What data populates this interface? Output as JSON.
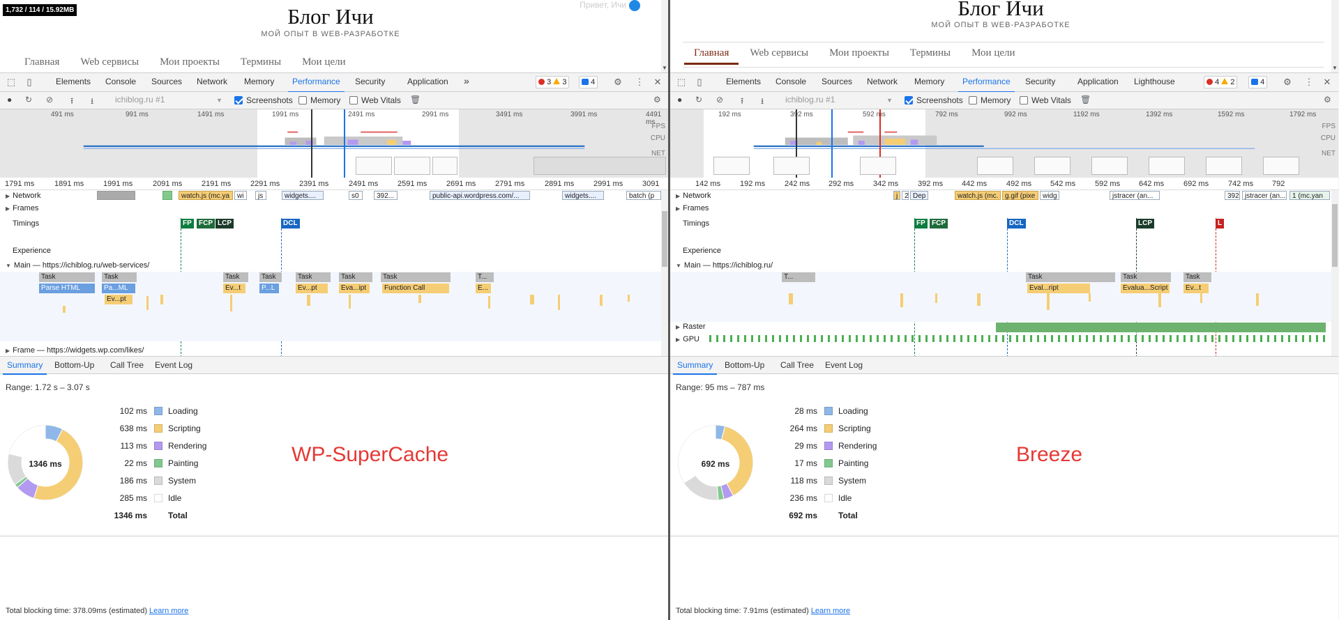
{
  "blog": {
    "title": "Блог Ичи",
    "subtitle": "МОЙ ОПЫТ В WEB-РАЗРАБОТКЕ",
    "nav": [
      "Главная",
      "Web сервисы",
      "Мои проекты",
      "Термины",
      "Мои цели"
    ],
    "greeting": "Привет, Ичи"
  },
  "fps_meter": "1,732 / 114 / 15.92MB",
  "devtools": {
    "tabs_left": [
      "Elements",
      "Console",
      "Sources",
      "Network",
      "Memory",
      "Performance",
      "Security",
      "Application"
    ],
    "tabs_right": [
      "Elements",
      "Console",
      "Sources",
      "Network",
      "Memory",
      "Performance",
      "Security",
      "Application",
      "Lighthouse"
    ],
    "active_tab": "Performance",
    "more_tabs": "»",
    "recording_select": "ichiblog.ru #1",
    "checkboxes": [
      "Screenshots",
      "Memory",
      "Web Vitals"
    ],
    "overview_labels": [
      "FPS",
      "CPU",
      "NET"
    ],
    "track_labels": {
      "network": "Network",
      "frames": "Frames",
      "timings": "Timings",
      "experience": "Experience",
      "raster": "Raster",
      "gpu": "GPU"
    },
    "summary_tabs": [
      "Summary",
      "Bottom-Up",
      "Call Tree",
      "Event Log"
    ],
    "legend_names": [
      "Loading",
      "Scripting",
      "Rendering",
      "Painting",
      "System",
      "Idle",
      "Total"
    ],
    "learn_more": "Learn more",
    "colors": {
      "loading": "#8fb7e8",
      "scripting": "#f5cd74",
      "rendering": "#b399f0",
      "painting": "#82c98e",
      "system": "#dadada",
      "idle": "#ffffff",
      "accent": "#1a73e8"
    }
  },
  "left": {
    "badges": {
      "errors": "3",
      "warnings": "3",
      "messages": "4"
    },
    "overview_ticks": [
      "491 ms",
      "991 ms",
      "1491 ms",
      "1991 ms",
      "2491 ms",
      "2991 ms",
      "3491 ms",
      "3991 ms",
      "4491 ms"
    ],
    "ruler_ticks": [
      "1791 ms",
      "1891 ms",
      "1991 ms",
      "2091 ms",
      "2191 ms",
      "2291 ms",
      "2391 ms",
      "2491 ms",
      "2591 ms",
      "2691 ms",
      "2791 ms",
      "2891 ms",
      "2991 ms",
      "3091"
    ],
    "network_items": [
      "watch.js (mc.ya",
      "wi",
      "js",
      "widgets....",
      "s0",
      "392...",
      "public-api.wordpress.com/...",
      "widgets....",
      "batch (p"
    ],
    "timing_marks": [
      "FP",
      "FCP",
      "LCP",
      "DCL"
    ],
    "main_label": "Main — https://ichiblog.ru/web-services/",
    "frame_label": "Frame — https://widgets.wp.com/likes/",
    "tasks": [
      "Task",
      "Task",
      "Task",
      "Task",
      "Task",
      "Task",
      "Task",
      "T..."
    ],
    "calls": [
      "Parse HTML",
      "Pa...ML",
      "Ev...t",
      "P...L",
      "Ev...pt",
      "Eva...ipt",
      "Function Call",
      "E..."
    ],
    "calls2": [
      "Ev...pt"
    ],
    "range": "Range: 1.72 s – 3.07 s",
    "values": [
      "102 ms",
      "638 ms",
      "113 ms",
      "22 ms",
      "186 ms",
      "285 ms",
      "1346 ms"
    ],
    "donut_ms": [
      102,
      638,
      113,
      22,
      186,
      285
    ],
    "total": "1346 ms",
    "plugin": "WP-SuperCache",
    "tbt": "Total blocking time: 378.09ms (estimated)"
  },
  "right": {
    "badges": {
      "errors": "4",
      "warnings": "2",
      "messages": "4"
    },
    "overview_ticks": [
      "192 ms",
      "392 ms",
      "592 ms",
      "792 ms",
      "992 ms",
      "1192 ms",
      "1392 ms",
      "1592 ms",
      "1792 ms"
    ],
    "ruler_ticks": [
      "142 ms",
      "192 ms",
      "242 ms",
      "292 ms",
      "342 ms",
      "392 ms",
      "442 ms",
      "492 ms",
      "542 ms",
      "592 ms",
      "642 ms",
      "692 ms",
      "742 ms",
      "792"
    ],
    "network_items": [
      "j",
      "2",
      "Dep",
      "watch.js (mc.",
      "g.gif (pixe",
      "widg",
      "jstracer (an...",
      "392",
      "jstracer (an...",
      "1 (mc.yan"
    ],
    "timing_marks": [
      "FP",
      "FCP",
      "DCL",
      "LCP",
      "L"
    ],
    "main_label": "Main — https://ichiblog.ru/",
    "tasks": [
      "T...",
      "Task",
      "Task",
      "Task"
    ],
    "calls": [
      "Eval...ript",
      "Evalua...Script",
      "Ev...t"
    ],
    "range": "Range: 95 ms – 787 ms",
    "values": [
      "28 ms",
      "264 ms",
      "29 ms",
      "17 ms",
      "118 ms",
      "236 ms",
      "692 ms"
    ],
    "donut_ms": [
      28,
      264,
      29,
      17,
      118,
      236
    ],
    "total": "692 ms",
    "plugin": "Breeze",
    "tbt": "Total blocking time: 7.91ms (estimated)"
  }
}
